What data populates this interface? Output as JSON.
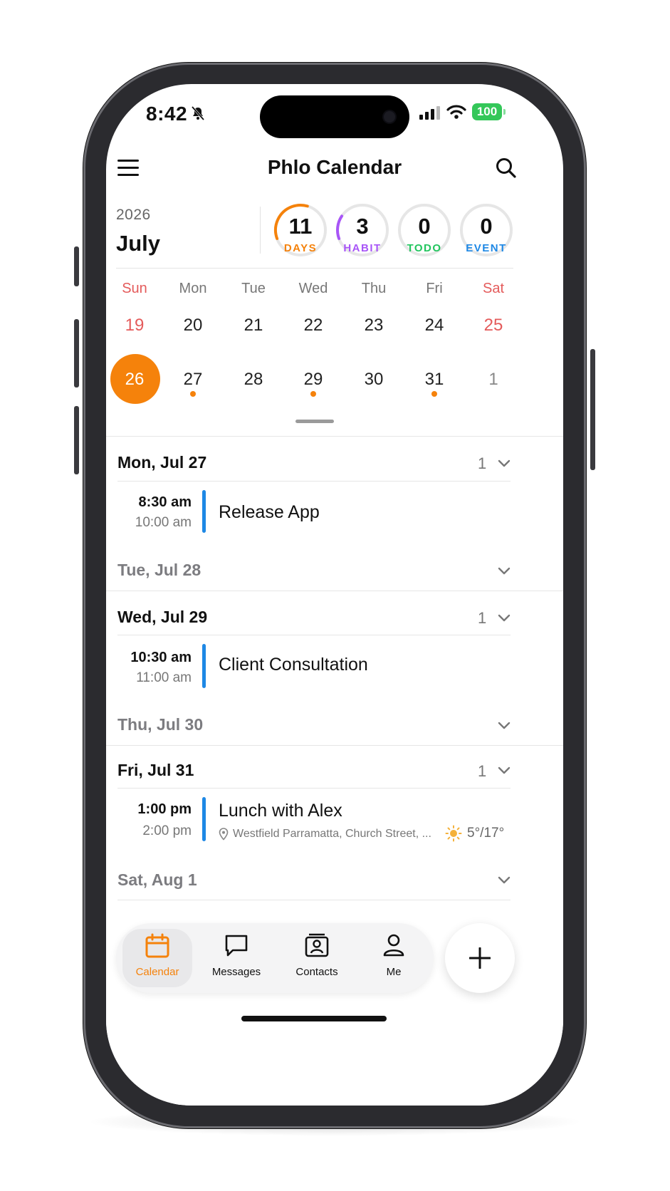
{
  "status_bar": {
    "time": "8:42",
    "battery": "100"
  },
  "header": {
    "title": "Phlo Calendar"
  },
  "summary": {
    "year": "2026",
    "month": "July",
    "stats": [
      {
        "value": "11",
        "label": "DAYS",
        "color": "#f5820b",
        "progress": 0.35
      },
      {
        "value": "3",
        "label": "HABIT",
        "color": "#a855f7",
        "progress": 0.15
      },
      {
        "value": "0",
        "label": "TODO",
        "color": "#22c55e",
        "progress": 0
      },
      {
        "value": "0",
        "label": "EVENT",
        "color": "#1e88e5",
        "progress": 0
      }
    ]
  },
  "week_days": [
    "Sun",
    "Mon",
    "Tue",
    "Wed",
    "Thu",
    "Fri",
    "Sat"
  ],
  "weeks": [
    [
      "19",
      "20",
      "21",
      "22",
      "23",
      "24",
      "25"
    ],
    [
      "26",
      "27",
      "28",
      "29",
      "30",
      "31",
      "1"
    ]
  ],
  "selected_day": "26",
  "days_with_events": [
    "27",
    "29",
    "31"
  ],
  "agenda": [
    {
      "header": "Mon, Jul 27",
      "count": "1",
      "events": [
        {
          "start": "8:30 am",
          "end": "10:00 am",
          "title": "Release App"
        }
      ]
    },
    {
      "header": "Tue, Jul 28",
      "count": "",
      "events": []
    },
    {
      "header": "Wed, Jul 29",
      "count": "1",
      "events": [
        {
          "start": "10:30 am",
          "end": "11:00 am",
          "title": "Client Consultation"
        }
      ]
    },
    {
      "header": "Thu, Jul 30",
      "count": "",
      "events": []
    },
    {
      "header": "Fri, Jul 31",
      "count": "1",
      "events": [
        {
          "start": "1:00 pm",
          "end": "2:00 pm",
          "title": "Lunch with Alex",
          "location": "Westfield Parramatta, Church Street, ...",
          "weather": "5°/17°"
        }
      ]
    },
    {
      "header": "Sat, Aug 1",
      "count": "",
      "events": []
    }
  ],
  "tabbar": {
    "items": [
      {
        "label": "Calendar",
        "icon": "calendar-icon",
        "active": true
      },
      {
        "label": "Messages",
        "icon": "message-icon",
        "active": false
      },
      {
        "label": "Contacts",
        "icon": "contacts-icon",
        "active": false
      },
      {
        "label": "Me",
        "icon": "person-icon",
        "active": false
      }
    ],
    "fab_icon": "plus-icon"
  },
  "colors": {
    "accent": "#f5820b",
    "weekend": "#e45b5b",
    "event_bar": "#1e88e5"
  }
}
